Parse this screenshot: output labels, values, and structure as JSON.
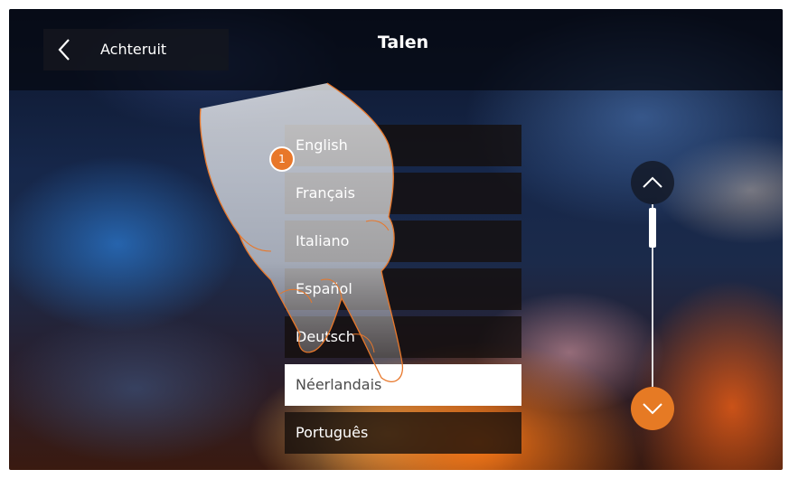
{
  "header": {
    "back_label": "Achteruit",
    "title": "Talen"
  },
  "languages": [
    {
      "label": "English",
      "selected": false
    },
    {
      "label": "Français",
      "selected": false
    },
    {
      "label": "Italiano",
      "selected": false
    },
    {
      "label": "Español",
      "selected": false
    },
    {
      "label": "Deutsch",
      "selected": false
    },
    {
      "label": "Néerlandais",
      "selected": true
    },
    {
      "label": "Português",
      "selected": false
    }
  ],
  "annotation": {
    "step_number": "1"
  },
  "icons": {
    "back": "chevron-left-icon",
    "scroll_up": "chevron-up-icon",
    "scroll_down": "chevron-down-icon"
  },
  "colors": {
    "accent": "#e67a24",
    "selected_bg": "#ffffff",
    "item_bg": "#140e0c"
  }
}
